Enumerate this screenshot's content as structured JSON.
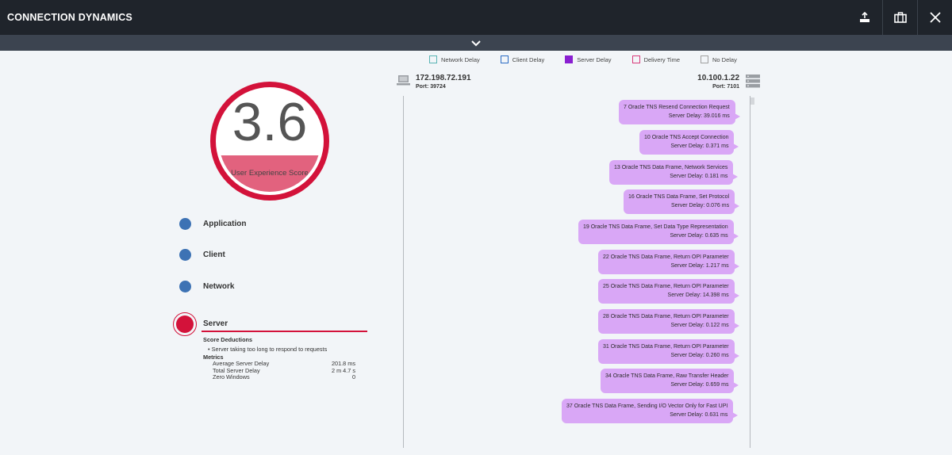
{
  "header": {
    "title": "CONNECTION DYNAMICS",
    "actions": [
      "export-icon",
      "briefcase-icon",
      "close-icon"
    ],
    "toggle_icon": "chevron-down-icon"
  },
  "legend": [
    {
      "label": "Network Delay",
      "color": "#5ab4b4",
      "filled": false
    },
    {
      "label": "Client Delay",
      "color": "#2b6cc4",
      "filled": false
    },
    {
      "label": "Server Delay",
      "color": "#8a1fd1",
      "filled": true
    },
    {
      "label": "Delivery Time",
      "color": "#d83a7a",
      "filled": false
    },
    {
      "label": "No Delay",
      "color": "#a0a0a0",
      "filled": false
    }
  ],
  "score": {
    "value": "3.6",
    "label": "User Experience Score",
    "fraction": 0.36,
    "color": "#d3123a"
  },
  "categories": [
    {
      "label": "Application"
    },
    {
      "label": "Client"
    },
    {
      "label": "Network"
    }
  ],
  "server": {
    "label": "Server",
    "deductions_title": "Score Deductions",
    "deduction": "Server taking too long to respond to requests",
    "metrics_title": "Metrics",
    "metrics": [
      {
        "name": "Average Server Delay",
        "value": "201.8 ms"
      },
      {
        "name": "Total Server Delay",
        "value": "2 m 4.7 s"
      },
      {
        "name": "Zero Windows",
        "value": "0"
      }
    ]
  },
  "client": {
    "ip": "172.198.72.191",
    "port": "Port: 39724"
  },
  "server_host": {
    "ip": "10.100.1.22",
    "port": "Port: 7101"
  },
  "messages": [
    {
      "title": "7   Oracle TNS Resend Connection Request",
      "delay": "Server Delay:  39.016 ms"
    },
    {
      "title": "10   Oracle TNS Accept Connection",
      "delay": "Server Delay:  0.371 ms"
    },
    {
      "title": "13   Oracle TNS Data Frame, Network Services",
      "delay": "Server Delay:  0.181 ms"
    },
    {
      "title": "16   Oracle TNS Data Frame, Set Protocol",
      "delay": "Server Delay:  0.076 ms"
    },
    {
      "title": "19   Oracle TNS Data Frame, Set Data Type Representation",
      "delay": "Server Delay:  0.635 ms"
    },
    {
      "title": "22   Oracle TNS Data Frame, Return OPI Parameter",
      "delay": "Server Delay:  1.217 ms"
    },
    {
      "title": "25   Oracle TNS Data Frame, Return OPI Parameter",
      "delay": "Server Delay:  14.398 ms"
    },
    {
      "title": "28   Oracle TNS Data Frame, Return OPI Parameter",
      "delay": "Server Delay:  0.122 ms"
    },
    {
      "title": "31   Oracle TNS Data Frame, Return OPI Parameter",
      "delay": "Server Delay:  0.260 ms"
    },
    {
      "title": "34   Oracle TNS Data Frame, Raw Transfer Header",
      "delay": "Server Delay:  0.659 ms"
    },
    {
      "title": "37   Oracle TNS Data Frame, Sending I/O Vector Only for Fast UPI",
      "delay": "Server Delay:  0.631 ms"
    }
  ]
}
